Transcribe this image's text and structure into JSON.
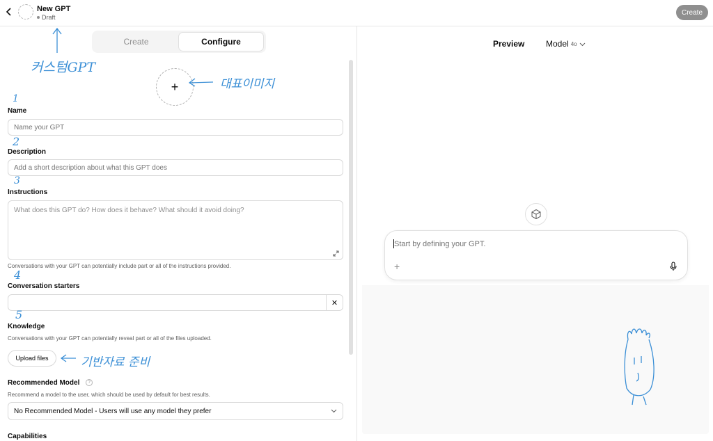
{
  "header": {
    "title": "New GPT",
    "status": "Draft",
    "create_label": "Create"
  },
  "tabs": [
    {
      "label": "Create"
    },
    {
      "label": "Configure"
    }
  ],
  "form": {
    "image_glyph": "+",
    "name": {
      "label": "Name",
      "placeholder": "Name your GPT",
      "value": ""
    },
    "description": {
      "label": "Description",
      "placeholder": "Add a short description about what this GPT does",
      "value": ""
    },
    "instructions": {
      "label": "Instructions",
      "placeholder": "What does this GPT do? How does it behave? What should it avoid doing?",
      "hint": "Conversations with your GPT can potentially include part or all of the instructions provided."
    },
    "starters": {
      "label": "Conversation starters",
      "value": "",
      "remove_glyph": "✕"
    },
    "knowledge": {
      "label": "Knowledge",
      "hint": "Conversations with your GPT can potentially reveal part or all of the files uploaded.",
      "upload_label": "Upload files"
    },
    "recommended_model": {
      "label": "Recommended Model",
      "help_glyph": "?",
      "hint": "Recommend a model to the user, which should be used by default for best results.",
      "selected": "No Recommended Model - Users will use any model they prefer"
    },
    "capabilities": {
      "label": "Capabilities"
    }
  },
  "annotations": {
    "custom_gpt": "커스텀GPT",
    "rep_image": "대표이미지",
    "n1": "1",
    "n2": "2",
    "n3": "3",
    "n4": "4",
    "n5": "5",
    "base_data": "기반자료 준비"
  },
  "preview": {
    "title": "Preview",
    "model_label": "Model",
    "model_version": "4o",
    "composer_placeholder": "Start by defining your GPT.",
    "attach_glyph": "+"
  },
  "colors": {
    "annotation": "#3b8fd6",
    "create_button_bg": "#8f8f8f",
    "border": "#d9d9d9"
  },
  "icons": [
    "chevron-left-icon",
    "plus-icon",
    "expand-icon",
    "close-icon",
    "chevron-down-icon",
    "question-icon",
    "cube-icon",
    "microphone-icon"
  ]
}
